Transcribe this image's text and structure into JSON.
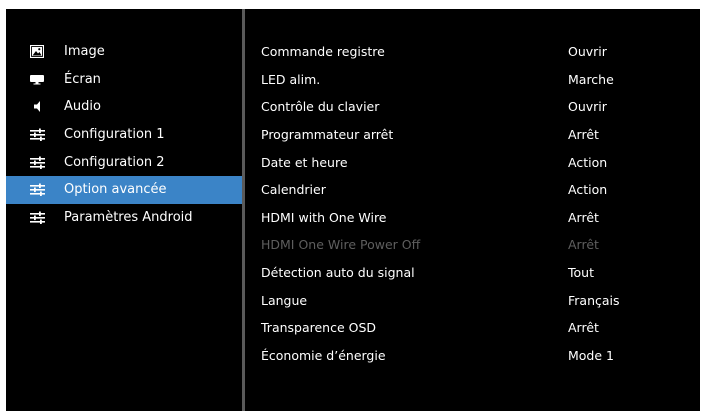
{
  "sidebar": {
    "selected_index": 5,
    "items": [
      {
        "label": "Image",
        "icon": "image-icon"
      },
      {
        "label": "Écran",
        "icon": "screen-icon"
      },
      {
        "label": "Audio",
        "icon": "speaker-icon"
      },
      {
        "label": "Configuration 1",
        "icon": "sliders-icon"
      },
      {
        "label": "Configuration 2",
        "icon": "sliders-icon"
      },
      {
        "label": "Option avancée",
        "icon": "sliders-icon"
      },
      {
        "label": "Paramètres Android",
        "icon": "sliders-icon"
      }
    ]
  },
  "settings": {
    "rows": [
      {
        "name": "Commande registre",
        "value": "Ouvrir"
      },
      {
        "name": "LED alim.",
        "value": "Marche"
      },
      {
        "name": "Contrôle du clavier",
        "value": "Ouvrir"
      },
      {
        "name": "Programmateur arrêt",
        "value": "Arrêt"
      },
      {
        "name": "Date et heure",
        "value": "Action"
      },
      {
        "name": "Calendrier",
        "value": "Action"
      },
      {
        "name": "HDMI with One Wire",
        "value": "Arrêt"
      },
      {
        "name": "HDMI One Wire Power Off",
        "value": "Arrêt",
        "disabled": true
      },
      {
        "name": "Détection auto du signal",
        "value": "Tout"
      },
      {
        "name": "Langue",
        "value": "Français"
      },
      {
        "name": "Transparence OSD",
        "value": "Arrêt"
      },
      {
        "name": "Économie d’énergie",
        "value": "Mode 1"
      }
    ]
  },
  "colors": {
    "background": "#000000",
    "selected": "#3b84c7",
    "text": "#ffffff",
    "disabled_text": "#5e5e5e",
    "divider": "#5a5a5a"
  }
}
